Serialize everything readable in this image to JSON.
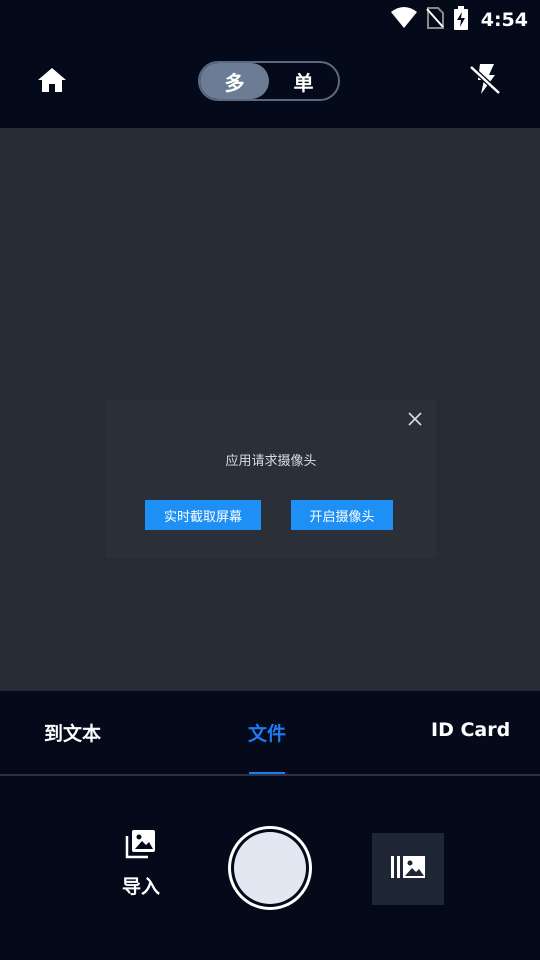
{
  "status_bar": {
    "time": "4:54",
    "icons": [
      "wifi-icon",
      "no-sim-icon",
      "battery-charging-icon"
    ]
  },
  "top_bar": {
    "home_icon": "home-icon",
    "mode_toggle": {
      "options": [
        "多",
        "单"
      ],
      "selected": "多"
    },
    "flash_icon": "flash-off-icon"
  },
  "dialog": {
    "message": "应用请求摄像头",
    "primary_button": "实时截取屏幕",
    "secondary_button": "开启摄像头",
    "close_icon": "close-icon",
    "button_color": "#1e90f5"
  },
  "mode_tabs": {
    "tabs": [
      "到文本",
      "文件",
      "ID Card"
    ],
    "selected": "文件",
    "accent": "#1e7cf2"
  },
  "bottom_bar": {
    "import_label": "导入",
    "import_icon": "gallery-import-icon",
    "gallery_icon": "gallery-icon"
  }
}
